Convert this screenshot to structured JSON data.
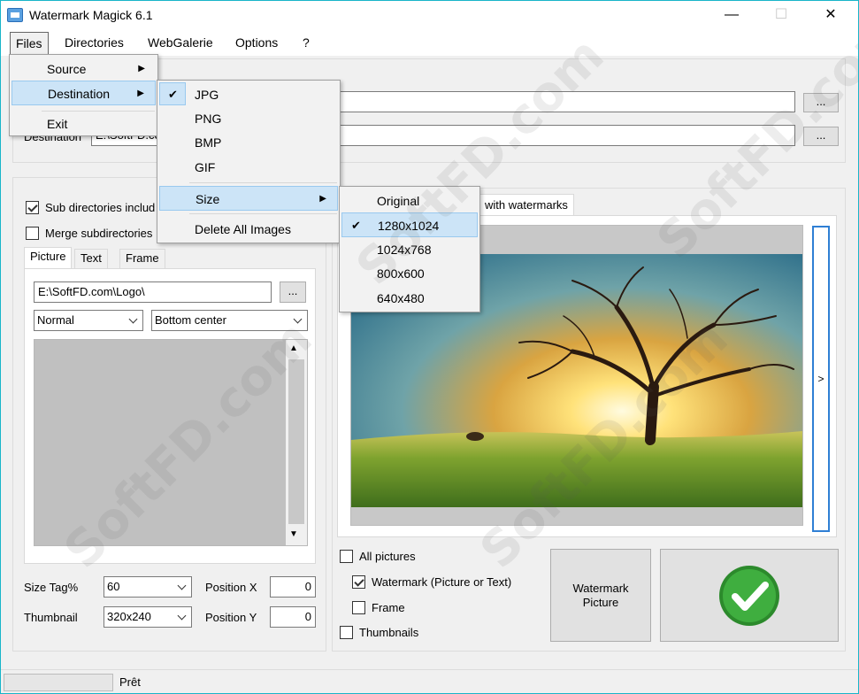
{
  "window": {
    "title": "Watermark Magick 6.1",
    "minimize": "—",
    "maximize": "☐",
    "close": "✕"
  },
  "menubar": [
    "Files",
    "Directories",
    "WebGalerie",
    "Options",
    "?"
  ],
  "files_menu": {
    "source": "Source",
    "destination": "Destination",
    "exit": "Exit"
  },
  "destination_menu": {
    "jpg": "JPG",
    "png": "PNG",
    "bmp": "BMP",
    "gif": "GIF",
    "size": "Size",
    "delete_all": "Delete All Images"
  },
  "size_menu": {
    "original": "Original",
    "s1280": "1280x1024",
    "s1024": "1024x768",
    "s800": "800x600",
    "s640": "640x480",
    "selected": "1280x1024"
  },
  "paths": {
    "source_value": "",
    "destination_label": "Destination",
    "destination_value": "E:\\SoftFD.com\\De",
    "browse": "..."
  },
  "options": {
    "sub_directories": "Sub directories includ",
    "merge_subdirectories": "Merge subdirectories",
    "sub_directories_checked": true,
    "merge_checked": false
  },
  "tabs": {
    "picture": "Picture",
    "text": "Text",
    "frame": "Frame"
  },
  "picture_panel": {
    "logo_path": "E:\\SoftFD.com\\Logo\\",
    "browse": "...",
    "blend_mode": "Normal",
    "position": "Bottom center"
  },
  "bottom_left": {
    "size_tag_label": "Size Tag%",
    "size_tag_value": "60",
    "thumbnail_label": "Thumbnail",
    "thumbnail_value": "320x240",
    "position_x_label": "Position X",
    "position_x_value": "0",
    "position_y_label": "Position Y",
    "position_y_value": "0"
  },
  "preview": {
    "tab_label": "with watermarks",
    "next": ">"
  },
  "process_options": {
    "all_pictures": "All pictures",
    "watermark": "Watermark (Picture or Text)",
    "frame": "Frame",
    "thumbnails": "Thumbnails",
    "watermark_checked": true
  },
  "buttons": {
    "watermark_picture": "Watermark Picture"
  },
  "status": {
    "text": "Prêt"
  },
  "overlay_watermark": "SoftFD.com"
}
